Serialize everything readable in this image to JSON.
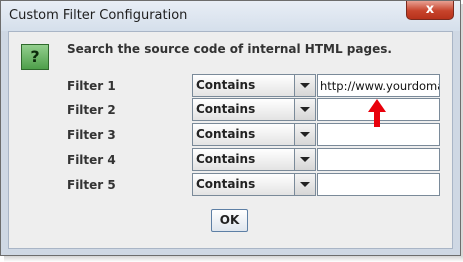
{
  "window": {
    "title": "Custom Filter Configuration",
    "close_symbol": "x"
  },
  "dialog": {
    "help_icon": "question-mark",
    "help_symbol": "?",
    "heading": "Search the source code of internal HTML pages."
  },
  "filters": [
    {
      "label": "Filter 1",
      "condition": "Contains",
      "value": "http://www.yourdomain"
    },
    {
      "label": "Filter 2",
      "condition": "Contains",
      "value": ""
    },
    {
      "label": "Filter 3",
      "condition": "Contains",
      "value": ""
    },
    {
      "label": "Filter 4",
      "condition": "Contains",
      "value": ""
    },
    {
      "label": "Filter 5",
      "condition": "Contains",
      "value": ""
    }
  ],
  "ok_label": "OK",
  "annotation": {
    "icon": "red-up-arrow",
    "color": "#e8000b"
  },
  "colors": {
    "close_button": "#c7432b",
    "help_icon": "#4e9f4a",
    "frame": "#cfd8e4",
    "panel": "#eeeeee"
  }
}
